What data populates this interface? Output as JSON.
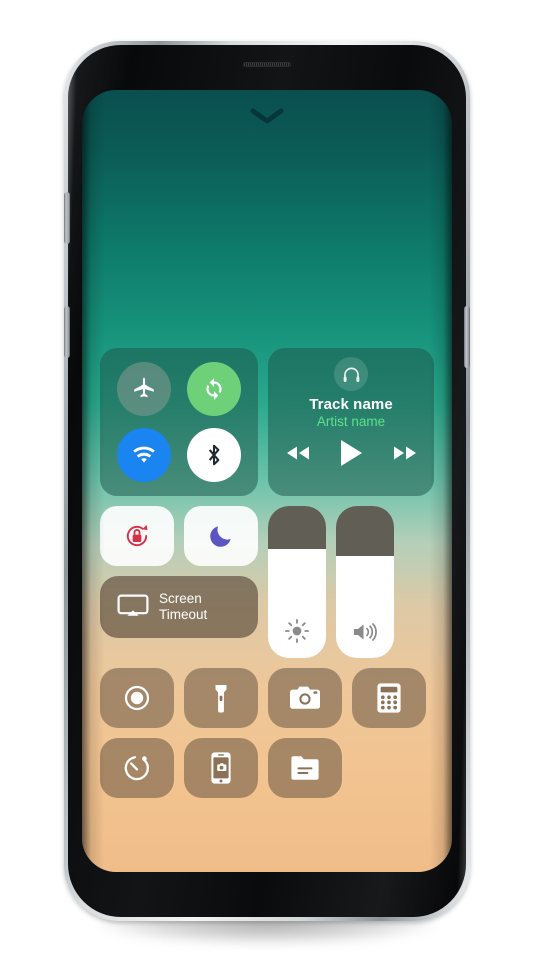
{
  "device": {
    "type": "smartphone",
    "earpiece": "speaker-grille",
    "buttons": [
      "volume-up",
      "volume-down",
      "power"
    ]
  },
  "screen": {
    "gesture_hint": "chevron-down-icon",
    "background_colors": {
      "top": "#0a4f4f",
      "mid": "#2aa98d",
      "bottom": "#f0bd89"
    }
  },
  "control_center": {
    "connectivity": {
      "panel_name": "connectivity-panel",
      "toggles": [
        {
          "name": "airplane-mode",
          "icon": "airplane-icon",
          "state": "off",
          "color": "#7a968c"
        },
        {
          "name": "sync",
          "icon": "sync-icon",
          "state": "on",
          "color": "#6fd07a"
        },
        {
          "name": "wifi",
          "icon": "wifi-icon",
          "state": "on",
          "color": "#1a84f0"
        },
        {
          "name": "bluetooth",
          "icon": "bluetooth-icon",
          "state": "on",
          "color": "#ffffff"
        }
      ]
    },
    "media": {
      "panel_name": "media-player-panel",
      "badge_icon": "headphones-icon",
      "track_title": "Track name",
      "artist": "Artist name",
      "artist_color": "#5fe08a",
      "controls": [
        {
          "name": "previous-track",
          "icon": "rewind-icon"
        },
        {
          "name": "play",
          "icon": "play-icon"
        },
        {
          "name": "next-track",
          "icon": "fast-forward-icon"
        }
      ]
    },
    "quick_toggles": [
      {
        "name": "rotation-lock",
        "icon": "rotation-lock-icon",
        "state": "on",
        "color": "#d6304a"
      },
      {
        "name": "do-not-disturb",
        "icon": "moon-icon",
        "state": "off",
        "color": "#5b55c4"
      }
    ],
    "screen_timeout": {
      "name": "screen-timeout-tile",
      "icon": "screen-cast-icon",
      "label_line1": "Screen",
      "label_line2": "Timeout"
    },
    "sliders": [
      {
        "name": "brightness-slider",
        "icon": "brightness-icon",
        "value": 72,
        "unit": "%"
      },
      {
        "name": "volume-slider",
        "icon": "volume-icon",
        "value": 67,
        "unit": "%"
      }
    ],
    "shortcuts_row1": [
      {
        "name": "screen-record",
        "icon": "record-icon"
      },
      {
        "name": "flashlight",
        "icon": "flashlight-icon"
      },
      {
        "name": "camera",
        "icon": "camera-icon"
      },
      {
        "name": "calculator",
        "icon": "calculator-icon"
      }
    ],
    "shortcuts_row2": [
      {
        "name": "timer",
        "icon": "timer-icon"
      },
      {
        "name": "screenshot",
        "icon": "screenshot-icon"
      },
      {
        "name": "file-manager",
        "icon": "folder-icon"
      }
    ]
  }
}
